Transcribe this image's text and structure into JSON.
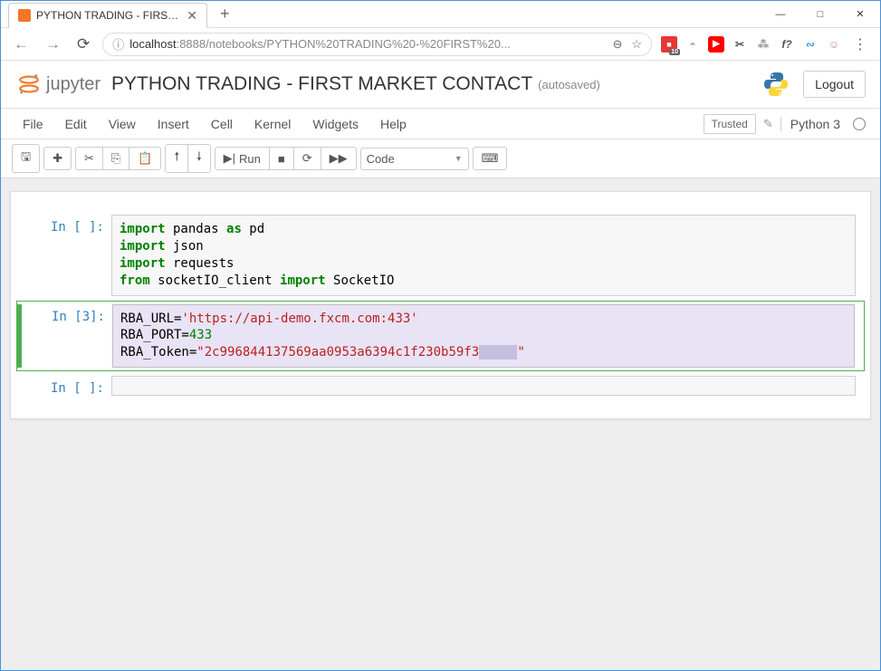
{
  "browser": {
    "tab_title": "PYTHON TRADING - FIRST MARK",
    "add_tab": "+",
    "win_min": "—",
    "win_max": "□",
    "win_close": "✕",
    "back": "←",
    "forward": "→",
    "reload": "⟳",
    "url_host": "localhost",
    "url_path": ":8888/notebooks/PYTHON%20TRADING%20-%20FIRST%20...",
    "info_icon": "ⓘ",
    "zoom": "⊖",
    "star": "☆",
    "ext_badge": "10",
    "scissors": "✂",
    "fq": "f?",
    "menu": "⋮"
  },
  "header": {
    "logo_text": "jupyter",
    "title": "PYTHON TRADING - FIRST MARKET CONTACT",
    "autosave": "(autosaved)",
    "logout": "Logout"
  },
  "menu": {
    "file": "File",
    "edit": "Edit",
    "view": "View",
    "insert": "Insert",
    "cell": "Cell",
    "kernel": "Kernel",
    "widgets": "Widgets",
    "help": "Help",
    "trusted": "Trusted",
    "kernel_name": "Python 3"
  },
  "toolbar": {
    "save": "🖫",
    "add": "✚",
    "cut": "✂",
    "copy": "⎘",
    "paste": "📋",
    "up": "↑",
    "down": "↓",
    "run_icon": "▶",
    "run": "Run",
    "stop": "■",
    "restart": "⟳",
    "ff": "⏩",
    "cell_type": "Code",
    "dd_arrow": "▼",
    "cmd": "⌨"
  },
  "cells": [
    {
      "prompt": "In [ ]:",
      "code_html": "<span class='hl-kw'>import</span> pandas <span class='hl-kw'>as</span> pd\n<span class='hl-kw'>import</span> json\n<span class='hl-kw'>import</span> requests\n<span class='hl-kw'>from</span> socketIO_client <span class='hl-kw'>import</span> SocketIO"
    },
    {
      "prompt": "In [3]:",
      "selected": true,
      "code_html": "RBA_URL=<span class='hl-str'>'https://api-demo.fxcm.com:433'</span>\nRBA_PORT=<span class='hl-num'>433</span>\nRBA_Token=<span class='hl-str'>\"2c996844137569aa0953a6394c1f230b59f3<span class='hl-sel'>     </span>\"</span>"
    },
    {
      "prompt": "In [ ]:",
      "code_html": ""
    }
  ]
}
